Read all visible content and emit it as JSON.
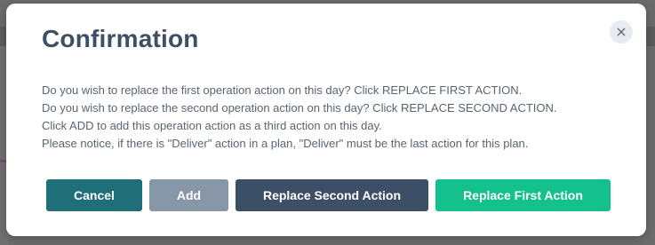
{
  "dialog": {
    "title": "Confirmation",
    "close_icon": "close-icon",
    "message_lines": [
      "Do you wish to replace the first operation action on this day? Click REPLACE FIRST ACTION.",
      "Do you wish to replace the second operation action on this day? Click REPLACE SECOND ACTION.",
      "Click ADD to add this operation action as a third action on this day.",
      "Please notice, if there is \"Deliver\" action in a plan, \"Deliver\" must be the last action for this plan."
    ],
    "buttons": {
      "cancel": "Cancel",
      "add": "Add",
      "replace_second": "Replace Second Action",
      "replace_first": "Replace First Action"
    }
  },
  "colors": {
    "title": "#3f4f63",
    "cancel_bg": "#1f6f7a",
    "add_bg": "#8797a7",
    "replace_second_bg": "#3d4f67",
    "replace_first_bg": "#14c08c",
    "overlay": "#6b6b6b"
  }
}
